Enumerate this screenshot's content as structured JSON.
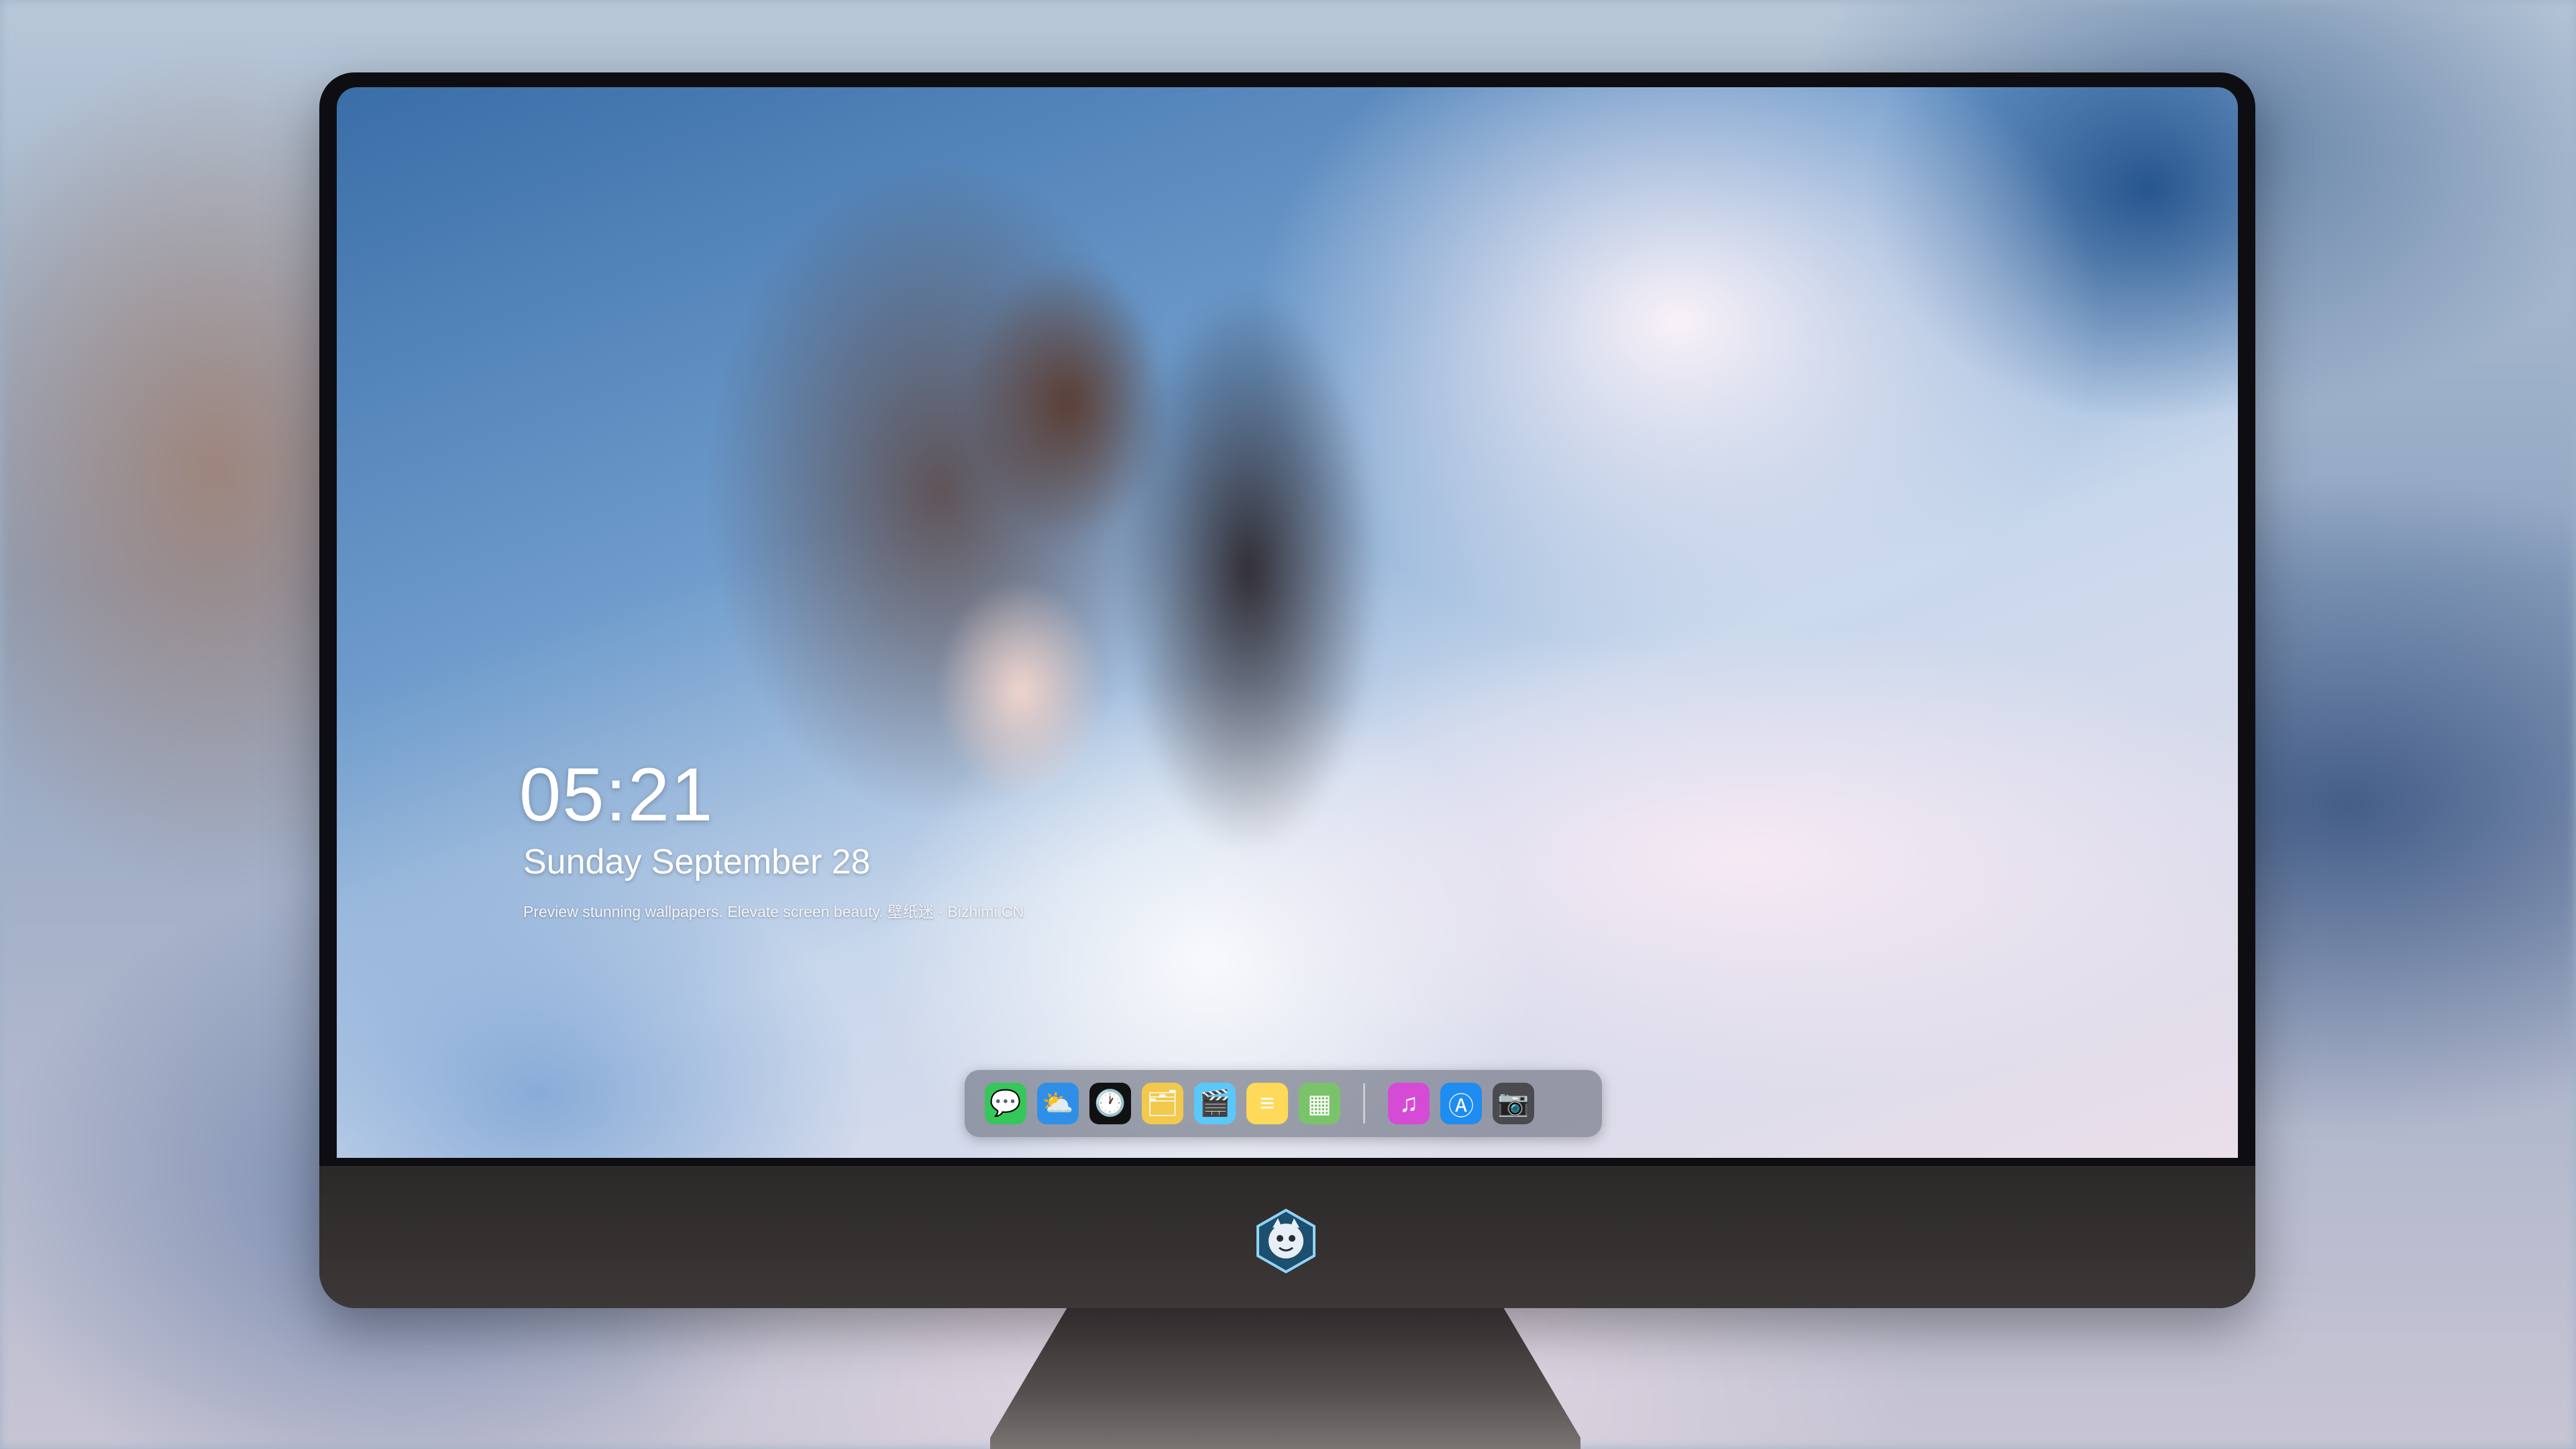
{
  "lockscreen": {
    "time": "05:21",
    "date": "Sunday September 28",
    "caption": "Preview stunning wallpapers. Elevate screen beauty. 壁纸迷 · Bizhimi.CN"
  },
  "dock": {
    "apps": [
      {
        "name": "messages",
        "icon": "messages-icon",
        "glyph": "💬",
        "color": "#35c759"
      },
      {
        "name": "weather",
        "icon": "weather-icon",
        "glyph": "⛅",
        "color": "#2f8fe8"
      },
      {
        "name": "clock",
        "icon": "clock-icon",
        "glyph": "🕐",
        "color": "#111111"
      },
      {
        "name": "preview",
        "icon": "preview-icon",
        "glyph": "🗂",
        "color": "#f2c94c"
      },
      {
        "name": "video",
        "icon": "clapper-icon",
        "glyph": "🎬",
        "color": "#5ac8fa"
      },
      {
        "name": "notes",
        "icon": "notes-icon",
        "glyph": "≡",
        "color": "#ffd95a"
      },
      {
        "name": "photos",
        "icon": "gallery-icon",
        "glyph": "▦",
        "color": "#7ac36a"
      },
      {
        "name": "music",
        "icon": "music-icon",
        "glyph": "♫",
        "color": "#d64bd6"
      },
      {
        "name": "app-store",
        "icon": "app-store-icon",
        "glyph": "Ⓐ",
        "color": "#1e8cf0"
      },
      {
        "name": "camera",
        "icon": "camera-icon",
        "glyph": "📷",
        "color": "#4a4a4f"
      }
    ]
  },
  "colors": {
    "bezel": "#0e0e12",
    "chin": "#3a3535",
    "dock_bg": "rgba(90,95,110,0.55)"
  }
}
